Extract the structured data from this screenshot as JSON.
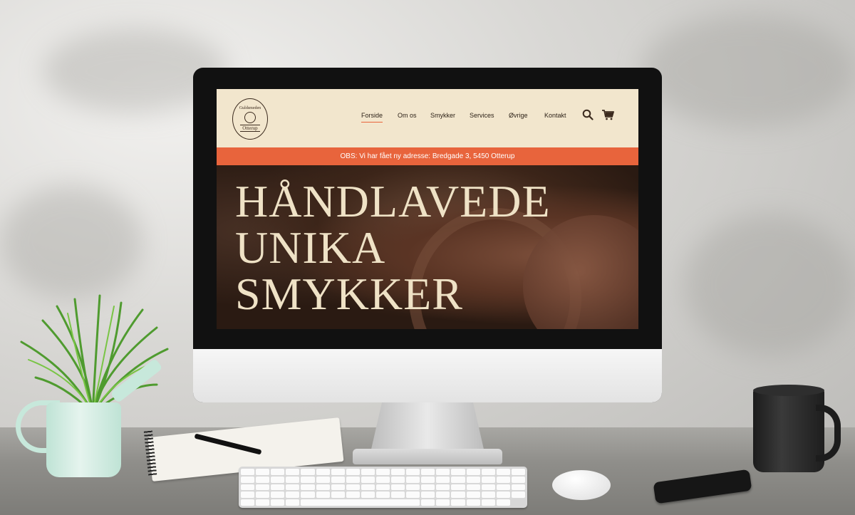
{
  "logo": {
    "top_text": "Guldsmeden",
    "bottom_text": "Otterup"
  },
  "nav": {
    "items": [
      {
        "label": "Forside",
        "active": true
      },
      {
        "label": "Om os",
        "active": false
      },
      {
        "label": "Smykker",
        "active": false
      },
      {
        "label": "Services",
        "active": false
      },
      {
        "label": "Øvrige",
        "active": false
      },
      {
        "label": "Kontakt",
        "active": false
      }
    ],
    "icons": [
      "search-icon",
      "cart-icon"
    ]
  },
  "banner": {
    "text": "OBS: Vi har fået ny adresse: Bredgade 3, 5450 Otterup"
  },
  "hero": {
    "line1": "HÅNDLAVEDE",
    "line2": "UNIKA",
    "line3": "SMYKKER"
  },
  "colors": {
    "header_bg": "#f2e6cd",
    "accent": "#e8643c",
    "text_dark": "#2d2218",
    "hero_text": "#efe2c6"
  }
}
